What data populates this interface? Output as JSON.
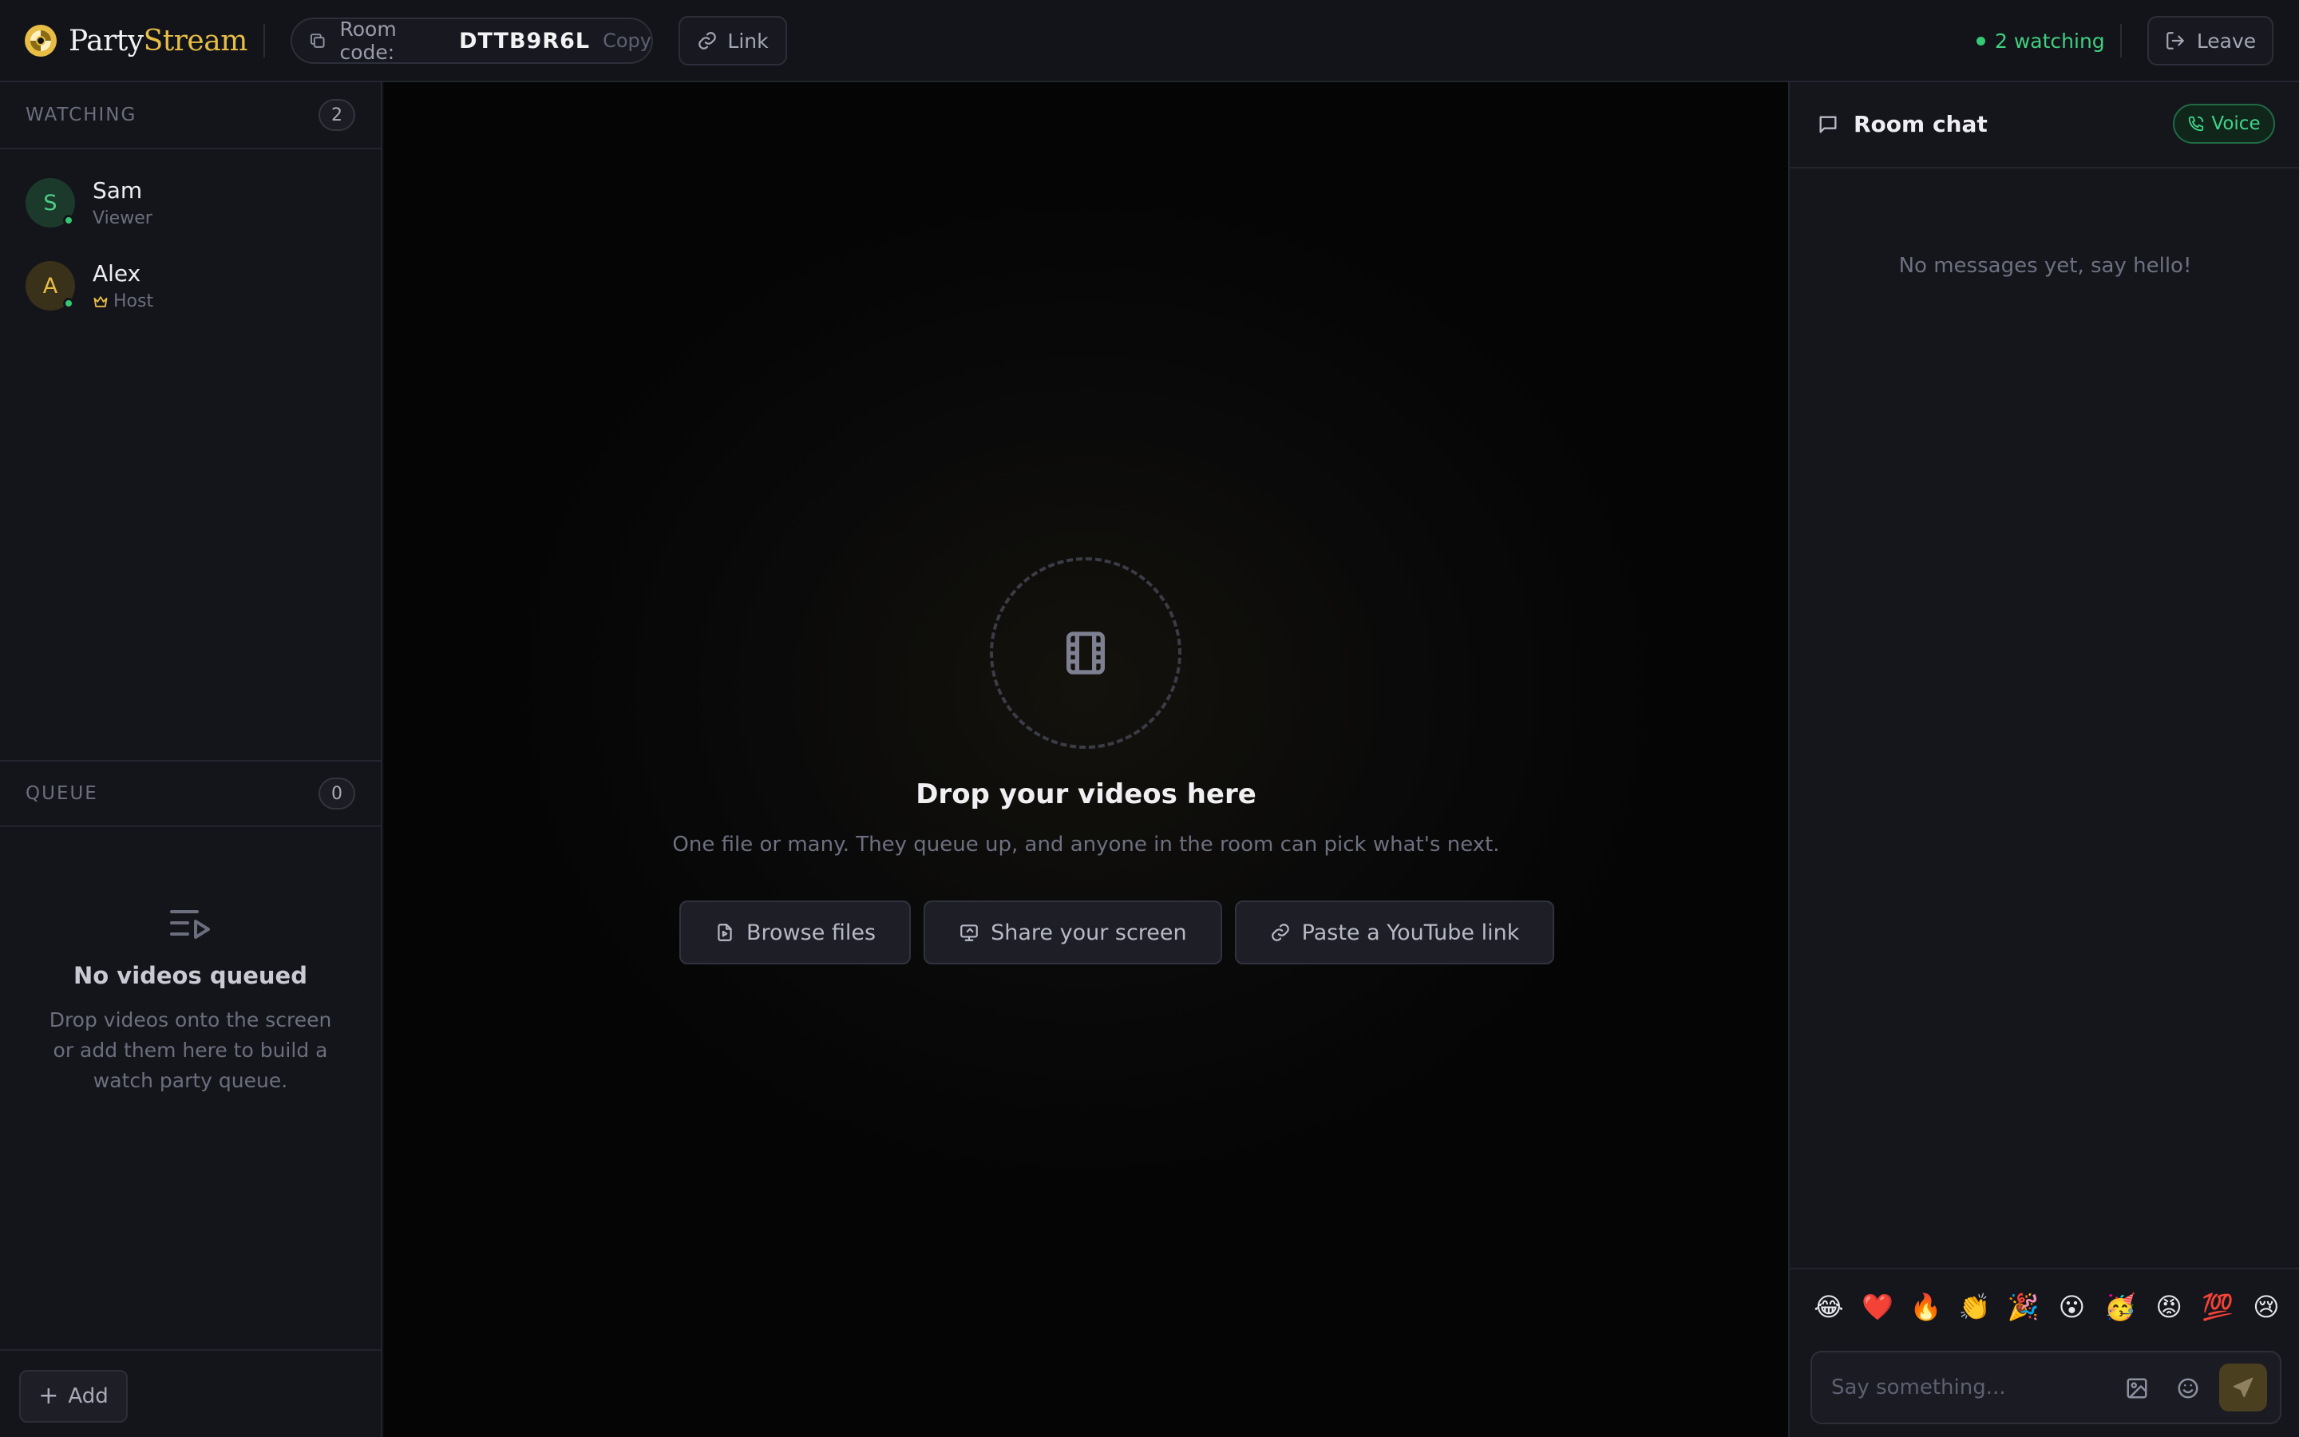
{
  "app": {
    "name_part1": "Party",
    "name_part2": "Stream"
  },
  "room": {
    "label": "Room code:",
    "code": "DTTB9R6L",
    "copy_label": "Copy",
    "link_label": "Link"
  },
  "status": {
    "watching_text": "2 watching",
    "leave_label": "Leave"
  },
  "sidebar": {
    "watching_title": "WATCHING",
    "watching_count": "2",
    "viewers": [
      {
        "initial": "S",
        "name": "Sam",
        "role": "Viewer",
        "avatar_color": "#1c3a2b",
        "initial_color": "#4ccf86"
      },
      {
        "initial": "A",
        "name": "Alex",
        "role": "Host",
        "avatar_color": "#3a311a",
        "initial_color": "#e7bd46"
      }
    ],
    "queue_title": "QUEUE",
    "queue_count": "0",
    "queue_empty_title": "No videos queued",
    "queue_empty_desc": "Drop videos onto the screen or add them here to build a watch party queue.",
    "add_label": "Add"
  },
  "stage": {
    "drop_title": "Drop your videos here",
    "drop_subtitle": "One file or many. They queue up, and anyone in the room can pick what's next.",
    "actions": [
      {
        "label": "Browse files",
        "icon": "file-icon"
      },
      {
        "label": "Share your screen",
        "icon": "screen-icon"
      },
      {
        "label": "Paste a YouTube link",
        "icon": "link-icon"
      }
    ]
  },
  "chat": {
    "title": "Room chat",
    "voice_label": "Voice",
    "empty_text": "No messages yet, say hello!",
    "reactions": [
      "😂",
      "❤️",
      "🔥",
      "👏",
      "🎉",
      "😮",
      "🥳",
      "😡",
      "💯",
      "😢"
    ],
    "input_placeholder": "Say something..."
  },
  "colors": {
    "accent": "#e7bd46",
    "online": "#36c774",
    "background": "#0b0c10",
    "panel": "#14151b"
  }
}
